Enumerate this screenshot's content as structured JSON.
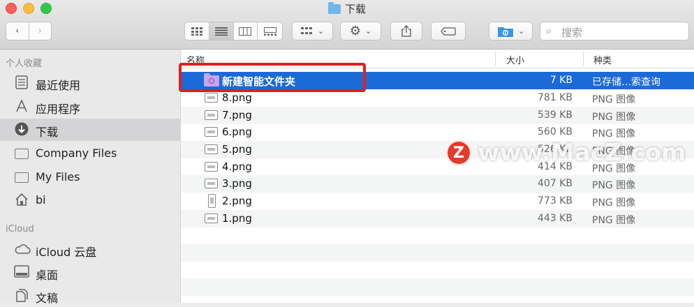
{
  "window": {
    "title": "下载",
    "title_icon": "downloads-folder-icon"
  },
  "toolbar": {
    "back_icon": "chevron-left-icon",
    "forward_icon": "chevron-right-icon",
    "view_modes": [
      "icon-view-icon",
      "list-view-icon",
      "column-view-icon",
      "gallery-view-icon"
    ],
    "selected_view": "list-view-icon",
    "arrange_icon": "group-icon",
    "action_icon": "gear-icon",
    "share_icon": "share-icon",
    "tag_icon": "tag-icon",
    "location_icon": "folder-icon",
    "search_placeholder": "搜索"
  },
  "sidebar": {
    "favorites_header": "个人收藏",
    "favorites": [
      {
        "label": "最近使用",
        "icon": "recents-icon"
      },
      {
        "label": "应用程序",
        "icon": "applications-icon"
      },
      {
        "label": "下载",
        "icon": "downloads-icon",
        "selected": true
      },
      {
        "label": "Company Files",
        "icon": "folder-icon"
      },
      {
        "label": "My Files",
        "icon": "folder-icon"
      },
      {
        "label": "bi",
        "icon": "home-icon"
      }
    ],
    "icloud_header": "iCloud",
    "icloud": [
      {
        "label": "iCloud 云盘",
        "icon": "cloud-icon"
      },
      {
        "label": "桌面",
        "icon": "desktop-icon"
      },
      {
        "label": "文稿",
        "icon": "documents-icon"
      }
    ]
  },
  "list": {
    "columns": {
      "name": "名称",
      "size": "大小",
      "kind": "种类"
    },
    "rows": [
      {
        "name": "新建智能文件夹",
        "size": "7 KB",
        "kind": "已存储…索查询",
        "icon": "smart-folder-icon",
        "selected": true
      },
      {
        "name": "8.png",
        "size": "781 KB",
        "kind": "PNG 图像",
        "icon": "png-file-icon"
      },
      {
        "name": "7.png",
        "size": "539 KB",
        "kind": "PNG 图像",
        "icon": "png-file-icon"
      },
      {
        "name": "6.png",
        "size": "560 KB",
        "kind": "PNG 图像",
        "icon": "png-file-icon"
      },
      {
        "name": "5.png",
        "size": "526 KB",
        "kind": "PNG 图像",
        "icon": "png-file-icon"
      },
      {
        "name": "4.png",
        "size": "414 KB",
        "kind": "PNG 图像",
        "icon": "png-file-icon"
      },
      {
        "name": "3.png",
        "size": "407 KB",
        "kind": "PNG 图像",
        "icon": "png-file-icon"
      },
      {
        "name": "2.png",
        "size": "773 KB",
        "kind": "PNG 图像",
        "icon": "png-file-icon"
      },
      {
        "name": "1.png",
        "size": "443 KB",
        "kind": "PNG 图像",
        "icon": "png-file-icon"
      }
    ]
  },
  "watermark": {
    "letter": "Z",
    "text": "www.MacZ.com"
  },
  "colors": {
    "selection": "#1b6ad7",
    "highlight_box": "#e02020",
    "smart_folder": "#c9a3ee"
  }
}
